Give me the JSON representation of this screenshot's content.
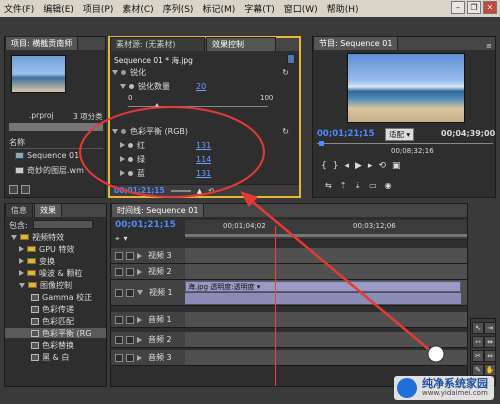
{
  "menu": [
    "文件(F)",
    "编辑(E)",
    "项目(P)",
    "素材(C)",
    "序列(S)",
    "标记(M)",
    "字幕(T)",
    "窗口(W)",
    "帮助(H)"
  ],
  "project": {
    "tab": "项目: 横截贡南师",
    "file": ".prproj",
    "count": "3 项分类",
    "name_header": "名称",
    "items": [
      "Sequence 01",
      "奇妙的图层.wm"
    ]
  },
  "source_tab": "素材源: (无素材)",
  "effect_tab": "效果控制",
  "effect_controls": {
    "seq_label": "Sequence 01 * 海.jpg",
    "sharpen_group": "锐化",
    "sharpen_amount_label": "锐化数量",
    "sharpen_amount": "20",
    "range_min": "0",
    "range_max": "100",
    "color_balance_group": "色彩平衡 (RGB)",
    "red_label": "红",
    "red_value": "131",
    "green_label": "绿",
    "green_value": "114",
    "blue_label": "蓝",
    "blue_value": "131",
    "timecode": "00;01;21;15"
  },
  "program": {
    "tab": "节目: Sequence 01",
    "timecode_left": "00;01;21;15",
    "fit_label": "适配",
    "timecode_right": "00;04;39;00",
    "ruler_mid": "00;08;32;16"
  },
  "effects_panel": {
    "tabs": [
      "信息",
      "效果"
    ],
    "search_label": "包含:",
    "items": [
      "视频特效",
      "GPU 特效",
      "变换",
      "噪波 & 颗粒",
      "图像控制",
      "Gamma 校正",
      "色彩传递",
      "色彩匹配",
      "色彩平衡 (RG",
      "色彩替换",
      "黑 & 白"
    ]
  },
  "timeline": {
    "tab": "时间线: Sequence 01",
    "timecode": "00;01;21;15",
    "ruler": [
      "00;01;04;02",
      "00;03;12;06"
    ],
    "tracks": [
      {
        "name": "视频 3"
      },
      {
        "name": "视频 2"
      },
      {
        "name": "视频 1",
        "clip": "海.jpg  透明度:透明度 ▾"
      },
      {
        "name": "音频 1"
      },
      {
        "name": "音频 2"
      },
      {
        "name": "音频 3"
      }
    ]
  },
  "watermark": {
    "brand": "纯净系统家园",
    "url": "www.yidaimei.com"
  },
  "colors": {
    "annotation": "#e53935",
    "timecode": "#4c8cff",
    "panel_border_active": "#e8b632"
  }
}
